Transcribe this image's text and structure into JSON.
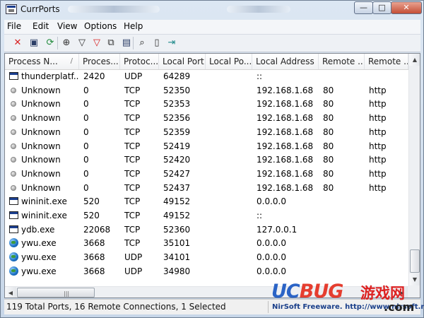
{
  "window": {
    "title": "CurrPorts"
  },
  "menu": [
    "File",
    "Edit",
    "View",
    "Options",
    "Help"
  ],
  "toolbar": [
    {
      "name": "delete-icon",
      "glyph": "✕",
      "color": "#d81e1e"
    },
    {
      "name": "save-icon",
      "glyph": "▣",
      "color": "#2b3d66"
    },
    {
      "name": "refresh-icon",
      "glyph": "⟳",
      "color": "#1f8a3a"
    },
    {
      "name": "properties-icon",
      "glyph": "⊕",
      "color": "#333333"
    },
    {
      "name": "filter-icon",
      "glyph": "▽",
      "color": "#333333"
    },
    {
      "name": "filter-red-icon",
      "glyph": "▽",
      "color": "#d81e1e"
    },
    {
      "name": "copy-icon",
      "glyph": "⧉",
      "color": "#333333"
    },
    {
      "name": "html-report-icon",
      "glyph": "▤",
      "color": "#2b3d66"
    },
    {
      "name": "find-icon",
      "glyph": "⌕",
      "color": "#111111"
    },
    {
      "name": "report-icon",
      "glyph": "▯",
      "color": "#333333"
    },
    {
      "name": "exit-icon",
      "glyph": "⇥",
      "color": "#1f8a8a"
    }
  ],
  "table": {
    "columns": [
      "Process N...",
      "Proces...",
      "Protoc...",
      "Local Port",
      "Local Po...",
      "Local Address",
      "Remote ...",
      "Remote ..."
    ],
    "sort_indicator": "/",
    "rows": [
      {
        "icon": "window",
        "process": "thunderplatf...",
        "pid": "2420",
        "protocol": "UDP",
        "local_port": "64289",
        "local_port_name": "",
        "local_address": "::",
        "remote_port": "",
        "remote_port_name": ""
      },
      {
        "icon": "dot",
        "process": "Unknown",
        "pid": "0",
        "protocol": "TCP",
        "local_port": "52350",
        "local_port_name": "",
        "local_address": "192.168.1.68",
        "remote_port": "80",
        "remote_port_name": "http"
      },
      {
        "icon": "dot",
        "process": "Unknown",
        "pid": "0",
        "protocol": "TCP",
        "local_port": "52353",
        "local_port_name": "",
        "local_address": "192.168.1.68",
        "remote_port": "80",
        "remote_port_name": "http"
      },
      {
        "icon": "dot",
        "process": "Unknown",
        "pid": "0",
        "protocol": "TCP",
        "local_port": "52356",
        "local_port_name": "",
        "local_address": "192.168.1.68",
        "remote_port": "80",
        "remote_port_name": "http"
      },
      {
        "icon": "dot",
        "process": "Unknown",
        "pid": "0",
        "protocol": "TCP",
        "local_port": "52359",
        "local_port_name": "",
        "local_address": "192.168.1.68",
        "remote_port": "80",
        "remote_port_name": "http"
      },
      {
        "icon": "dot",
        "process": "Unknown",
        "pid": "0",
        "protocol": "TCP",
        "local_port": "52419",
        "local_port_name": "",
        "local_address": "192.168.1.68",
        "remote_port": "80",
        "remote_port_name": "http"
      },
      {
        "icon": "dot",
        "process": "Unknown",
        "pid": "0",
        "protocol": "TCP",
        "local_port": "52420",
        "local_port_name": "",
        "local_address": "192.168.1.68",
        "remote_port": "80",
        "remote_port_name": "http"
      },
      {
        "icon": "dot",
        "process": "Unknown",
        "pid": "0",
        "protocol": "TCP",
        "local_port": "52427",
        "local_port_name": "",
        "local_address": "192.168.1.68",
        "remote_port": "80",
        "remote_port_name": "http"
      },
      {
        "icon": "dot",
        "process": "Unknown",
        "pid": "0",
        "protocol": "TCP",
        "local_port": "52437",
        "local_port_name": "",
        "local_address": "192.168.1.68",
        "remote_port": "80",
        "remote_port_name": "http"
      },
      {
        "icon": "window",
        "process": "wininit.exe",
        "pid": "520",
        "protocol": "TCP",
        "local_port": "49152",
        "local_port_name": "",
        "local_address": "0.0.0.0",
        "remote_port": "",
        "remote_port_name": ""
      },
      {
        "icon": "window",
        "process": "wininit.exe",
        "pid": "520",
        "protocol": "TCP",
        "local_port": "49152",
        "local_port_name": "",
        "local_address": "::",
        "remote_port": "",
        "remote_port_name": ""
      },
      {
        "icon": "window",
        "process": "ydb.exe",
        "pid": "22068",
        "protocol": "TCP",
        "local_port": "52360",
        "local_port_name": "",
        "local_address": "127.0.0.1",
        "remote_port": "",
        "remote_port_name": ""
      },
      {
        "icon": "globe",
        "process": "ywu.exe",
        "pid": "3668",
        "protocol": "TCP",
        "local_port": "35101",
        "local_port_name": "",
        "local_address": "0.0.0.0",
        "remote_port": "",
        "remote_port_name": ""
      },
      {
        "icon": "globe",
        "process": "ywu.exe",
        "pid": "3668",
        "protocol": "UDP",
        "local_port": "34101",
        "local_port_name": "",
        "local_address": "0.0.0.0",
        "remote_port": "",
        "remote_port_name": ""
      },
      {
        "icon": "globe",
        "process": "ywu.exe",
        "pid": "3668",
        "protocol": "UDP",
        "local_port": "34980",
        "local_port_name": "",
        "local_address": "0.0.0.0",
        "remote_port": "",
        "remote_port_name": ""
      }
    ]
  },
  "status": {
    "summary": "119 Total Ports, 16 Remote Connections, 1 Selected",
    "right": "NirSoft Freeware.  http://www.nirsoft.net"
  },
  "watermark": {
    "logo_a": "UC",
    "logo_b": "BUG",
    "cn": "游戏网",
    "com": ".com"
  }
}
